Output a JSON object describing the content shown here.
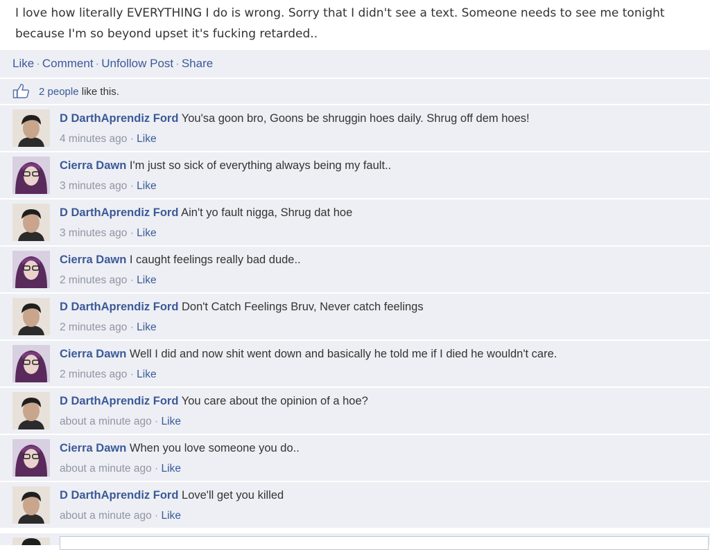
{
  "post": {
    "text": "I love how literally EVERYTHING I do is wrong. Sorry that I didn't see a text. Someone needs to see me tonight because I'm so beyond upset it's fucking retarded.."
  },
  "actions": {
    "like": "Like",
    "comment": "Comment",
    "unfollow": "Unfollow Post",
    "share": "Share",
    "separator": "·"
  },
  "likes": {
    "count_link": "2 people",
    "suffix": " like this."
  },
  "colors": {
    "link": "#3b5998",
    "panel_bg": "#edeff4",
    "meta": "#8f95a3"
  },
  "comments": [
    {
      "author": "D DarthAprendiz Ford",
      "text": "You'sa goon bro, Goons be shruggin hoes daily. Shrug off dem hoes!",
      "time": "4 minutes ago",
      "like": "Like",
      "avatar": "male-avatar"
    },
    {
      "author": "Cierra Dawn",
      "text": "I'm just so sick of everything always being my fault..",
      "time": "3 minutes ago",
      "like": "Like",
      "avatar": "female-avatar"
    },
    {
      "author": "D DarthAprendiz Ford",
      "text": "Ain't yo fault nigga, Shrug dat hoe",
      "time": "3 minutes ago",
      "like": "Like",
      "avatar": "male-avatar"
    },
    {
      "author": "Cierra Dawn",
      "text": "I caught feelings really bad dude..",
      "time": "2 minutes ago",
      "like": "Like",
      "avatar": "female-avatar"
    },
    {
      "author": "D DarthAprendiz Ford",
      "text": "Don't Catch Feelings Bruv, Never catch feelings",
      "time": "2 minutes ago",
      "like": "Like",
      "avatar": "male-avatar"
    },
    {
      "author": "Cierra Dawn",
      "text": "Well I did and now shit went down and basically he told me if I died he wouldn't care.",
      "time": "2 minutes ago",
      "like": "Like",
      "avatar": "female-avatar"
    },
    {
      "author": "D DarthAprendiz Ford",
      "text": "You care about the opinion of a hoe?",
      "time": "about a minute ago",
      "like": "Like",
      "avatar": "male-avatar"
    },
    {
      "author": "Cierra Dawn",
      "text": "When you love someone you do..",
      "time": "about a minute ago",
      "like": "Like",
      "avatar": "female-avatar"
    },
    {
      "author": "D DarthAprendiz Ford",
      "text": "Love'll get you killed",
      "time": "about a minute ago",
      "like": "Like",
      "avatar": "male-avatar"
    }
  ]
}
